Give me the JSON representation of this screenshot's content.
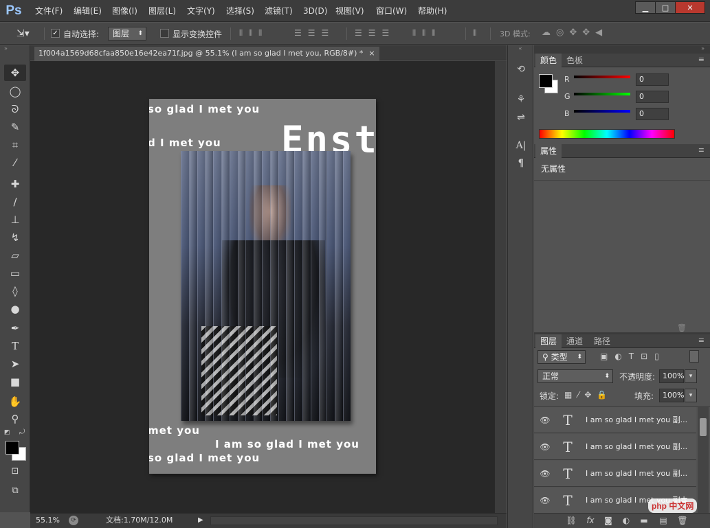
{
  "app": {
    "logo": "Ps"
  },
  "menu": [
    "文件(F)",
    "编辑(E)",
    "图像(I)",
    "图层(L)",
    "文字(Y)",
    "选择(S)",
    "滤镜(T)",
    "3D(D)",
    "视图(V)",
    "窗口(W)",
    "帮助(H)"
  ],
  "window_controls": {
    "minimize": "▁",
    "restore": "□",
    "close": "✕"
  },
  "options": {
    "auto_select_label": "自动选择:",
    "auto_select_checked": true,
    "auto_select_value": "图层",
    "show_transform_label": "显示变换控件",
    "show_transform_checked": false,
    "mode_3d_label": "3D 模式:"
  },
  "document": {
    "tab_title": "1f004a1569d68cfaa850e16e42ea71f.jpg @ 55.1% (I am so glad I met you, RGB/8#) *",
    "tab_close": "×"
  },
  "canvas_texts": {
    "line1": "so glad I met you",
    "line2": "d I met you",
    "big": "Enst",
    "line3": "met you",
    "line4": "I am so glad I met you",
    "line5": "so glad I met you"
  },
  "status": {
    "zoom": "55.1%",
    "doc_info": "文档:1.70M/12.0M"
  },
  "panels": {
    "color": {
      "tabs": [
        "颜色",
        "色板"
      ],
      "r_label": "R",
      "g_label": "G",
      "b_label": "B",
      "r": "0",
      "g": "0",
      "b": "0",
      "foreground": "#000000",
      "background": "#ffffff"
    },
    "properties": {
      "tab": "属性",
      "content": "无属性"
    },
    "layers": {
      "tabs": [
        "图层",
        "通道",
        "路径"
      ],
      "filter_kind": "类型",
      "blend_mode": "正常",
      "opacity_label": "不透明度:",
      "opacity": "100%",
      "lock_label": "锁定:",
      "fill_label": "填充:",
      "fill": "100%",
      "items": [
        {
          "name": "I am so glad I met you 副...",
          "type_glyph": "T",
          "visible": true
        },
        {
          "name": "I am so glad I met you 副...",
          "type_glyph": "T",
          "visible": true
        },
        {
          "name": "I am so glad I met you 副...",
          "type_glyph": "T",
          "visible": true
        },
        {
          "name": "I am so glad I met you 副本",
          "type_glyph": "T",
          "visible": true
        }
      ]
    }
  },
  "watermark": "php 中文网"
}
